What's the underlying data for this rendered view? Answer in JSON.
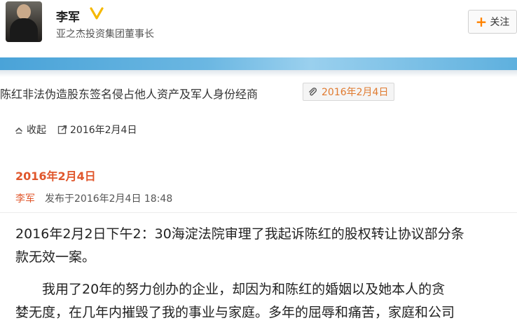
{
  "header": {
    "user_name": "李军",
    "user_title": "亚之杰投资集团董事长",
    "follow_label": "关注",
    "verified_color": "#f5b800"
  },
  "article": {
    "title": "陈红非法伪造股东签名侵占他人资产及军人身份经商",
    "title_date": "2016年2月4日"
  },
  "toolbar": {
    "collapse_label": "收起",
    "date_label": "2016年2月4日"
  },
  "post": {
    "date_heading": "2016年2月4日",
    "author": "李军",
    "published": "发布于2016年2月4日 18:48",
    "para1_lines": [
      "2016年2月2日下午2：30海淀法院审理了我起诉陈红的股权转让协议部分条",
      "款无效一案。"
    ],
    "para2_lines": [
      "我用了20年的努力创办的企业，却因为和陈红的婚姻以及她本人的贪",
      "婪无度，在几年内摧毁了我的事业与家庭。多年的屈辱和痛苦，家庭和公司"
    ]
  },
  "colors": {
    "accent": "#e0562b",
    "banner": "#4aa3d8"
  }
}
